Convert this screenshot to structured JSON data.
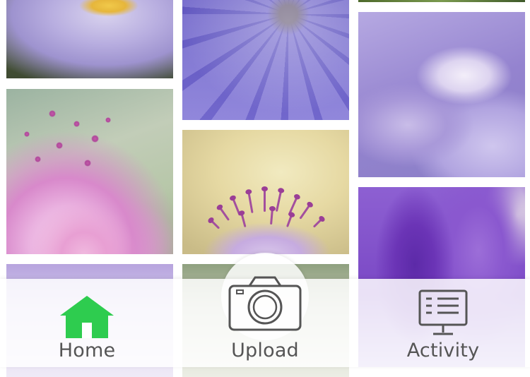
{
  "colors": {
    "active_tab": "#2ecc4f",
    "inactive_tab": "#555555",
    "tabbar_background": "rgba(255,255,255,0.84)"
  },
  "photos": [
    {
      "id": "aster-purple",
      "name": "photo-aster-purple"
    },
    {
      "id": "aster-pink",
      "name": "photo-aster-pink"
    },
    {
      "id": "flower-white",
      "name": "photo-flower-white"
    },
    {
      "id": "violet-petals",
      "name": "photo-violet-petals"
    },
    {
      "id": "scabiosa",
      "name": "photo-scabiosa"
    },
    {
      "id": "foliage",
      "name": "photo-foliage"
    },
    {
      "id": "greenery-strip",
      "name": "photo-greenery-strip"
    },
    {
      "id": "wisteria",
      "name": "photo-wisteria"
    },
    {
      "id": "iris",
      "name": "photo-iris"
    }
  ],
  "tabbar": {
    "active_tab": "home",
    "tabs": [
      {
        "id": "home",
        "label": "Home",
        "icon": "home-icon"
      },
      {
        "id": "upload",
        "label": "Upload",
        "icon": "camera-icon"
      },
      {
        "id": "activity",
        "label": "Activity",
        "icon": "activity-monitor-icon"
      }
    ]
  }
}
